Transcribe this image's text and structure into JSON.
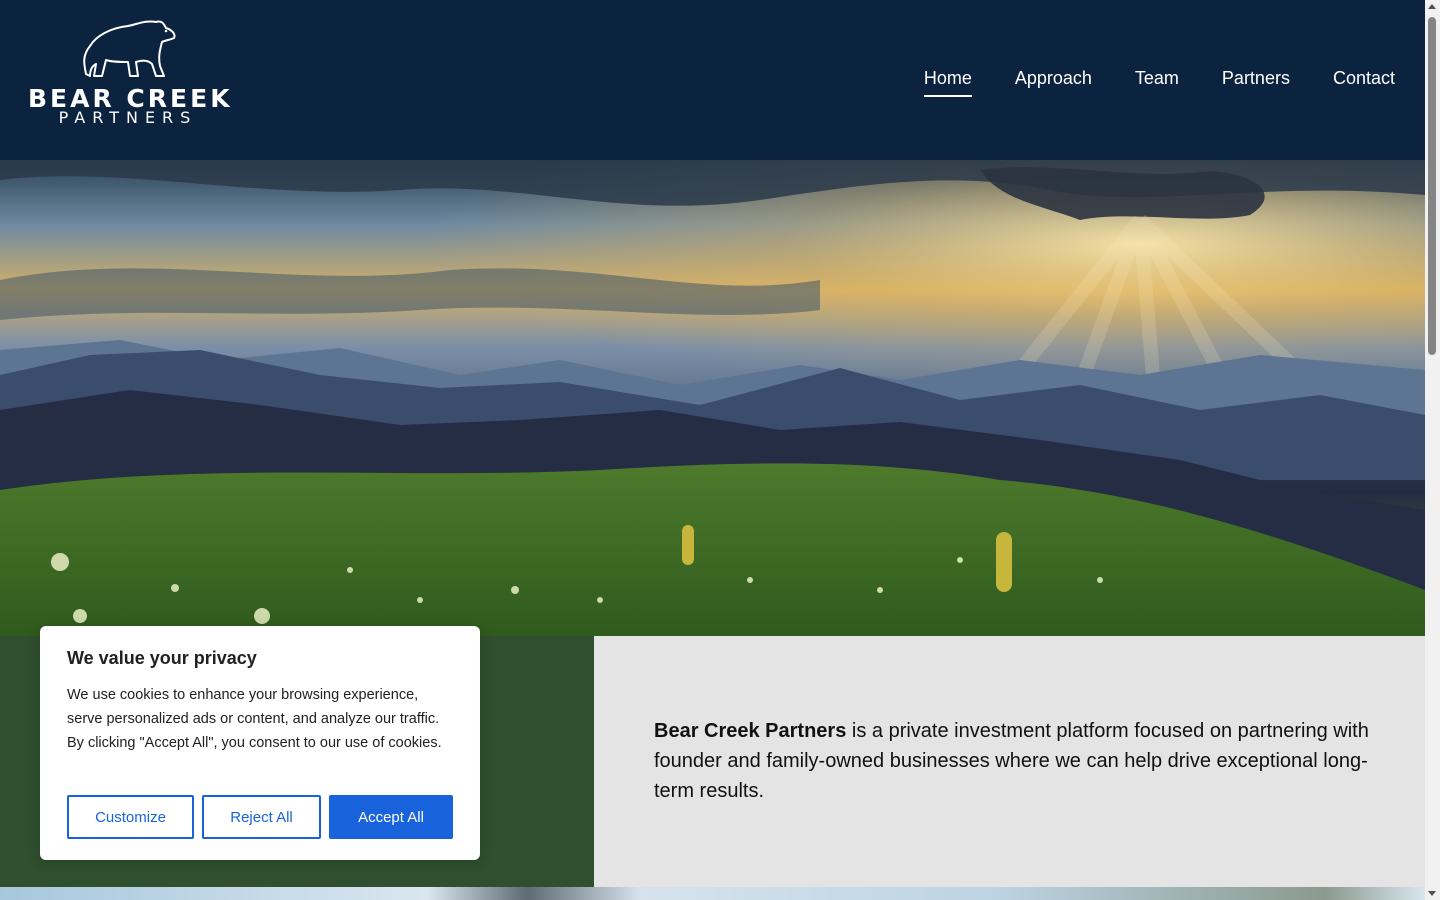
{
  "brand": {
    "name": "BEAR CREEK",
    "subtitle": "PARTNERS"
  },
  "nav": {
    "items": [
      {
        "label": "Home",
        "active": true
      },
      {
        "label": "Approach",
        "active": false
      },
      {
        "label": "Team",
        "active": false
      },
      {
        "label": "Partners",
        "active": false
      },
      {
        "label": "Contact",
        "active": false
      }
    ]
  },
  "intro": {
    "bold": "Bear Creek Partners",
    "text": " is a private investment platform focused on partnering with founder and family-owned businesses where we can help drive exceptional long-term results."
  },
  "cookie": {
    "title": "We value your privacy",
    "body": "We use cookies to enhance your browsing experience, serve personalized ads or content, and analyze our traffic. By clicking \"Accept All\", you consent to our use of cookies.",
    "customize": "Customize",
    "reject": "Reject All",
    "accept": "Accept All"
  },
  "colors": {
    "header_bg": "#0c2340",
    "green_panel": "#2f4f2f",
    "grey_panel": "#e4e4e4",
    "accent": "#1863dc"
  }
}
